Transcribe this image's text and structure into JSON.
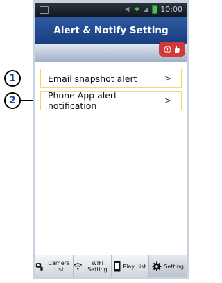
{
  "status_bar": {
    "time": "10:00"
  },
  "header": {
    "title": "Alert & Notify Setting"
  },
  "rows": [
    {
      "label": "Email snapshot alert",
      "chevron": ">"
    },
    {
      "label": "Phone App alert notification",
      "chevron": ">"
    }
  ],
  "callouts": [
    "1",
    "2"
  ],
  "tabs": [
    {
      "label": "Camera List",
      "icon": "camera-icon"
    },
    {
      "label": "WIFI Setting",
      "icon": "wifi-icon"
    },
    {
      "label": "Play List",
      "icon": "playlist-icon"
    },
    {
      "label": "Setting",
      "icon": "gear-icon"
    }
  ],
  "colors": {
    "header": "#173d7e",
    "alert_badge": "#d23a3a",
    "row_border": "#f0d94a",
    "callout_text": "#1a4ea3"
  }
}
